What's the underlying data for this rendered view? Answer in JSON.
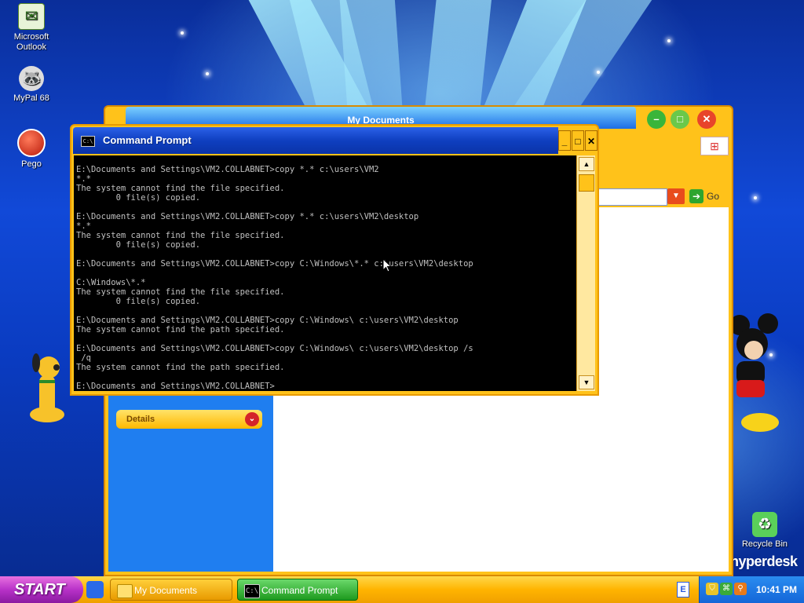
{
  "desktop": {
    "icons": [
      {
        "label": "Microsoft Outlook",
        "icon": "outlook-icon"
      },
      {
        "label": "MyPal 68",
        "icon": "mypal-icon"
      },
      {
        "label": "Pego",
        "icon": "pego-icon"
      },
      {
        "label": "Recycle Bin",
        "icon": "recycle-bin-icon"
      }
    ],
    "brand": "hyperdesk"
  },
  "mydocuments": {
    "title": "My Documents",
    "go_label": "Go",
    "details_label": "Details"
  },
  "cmd": {
    "title": "Command Prompt",
    "lines": [
      "E:\\Documents and Settings\\VM2.COLLABNET>copy *.* c:\\users\\VM2",
      "*.*",
      "The system cannot find the file specified.",
      "        0 file(s) copied.",
      "",
      "E:\\Documents and Settings\\VM2.COLLABNET>copy *.* c:\\users\\VM2\\desktop",
      "*.*",
      "The system cannot find the file specified.",
      "        0 file(s) copied.",
      "",
      "E:\\Documents and Settings\\VM2.COLLABNET>copy C:\\Windows\\*.* c:\\users\\VM2\\desktop",
      "",
      "C:\\Windows\\*.*",
      "The system cannot find the file specified.",
      "        0 file(s) copied.",
      "",
      "E:\\Documents and Settings\\VM2.COLLABNET>copy C:\\Windows\\ c:\\users\\VM2\\desktop",
      "The system cannot find the path specified.",
      "",
      "E:\\Documents and Settings\\VM2.COLLABNET>copy C:\\Windows\\ c:\\users\\VM2\\desktop /s",
      " /q",
      "The system cannot find the path specified.",
      "",
      "E:\\Documents and Settings\\VM2.COLLABNET>"
    ]
  },
  "taskbar": {
    "start_label": "START",
    "buttons": [
      {
        "label": "My Documents",
        "icon": "folder-icon"
      },
      {
        "label": "Command Prompt",
        "icon": "cmd-icon"
      }
    ],
    "language": "E",
    "clock": "10:41 PM"
  },
  "colors": {
    "taskbar": "#ffb400",
    "start": "#b832c8",
    "window_frame": "#ffc21a",
    "titlebar": "#0f3fc0",
    "console_bg": "#000000",
    "console_fg": "#c0c0c0"
  }
}
